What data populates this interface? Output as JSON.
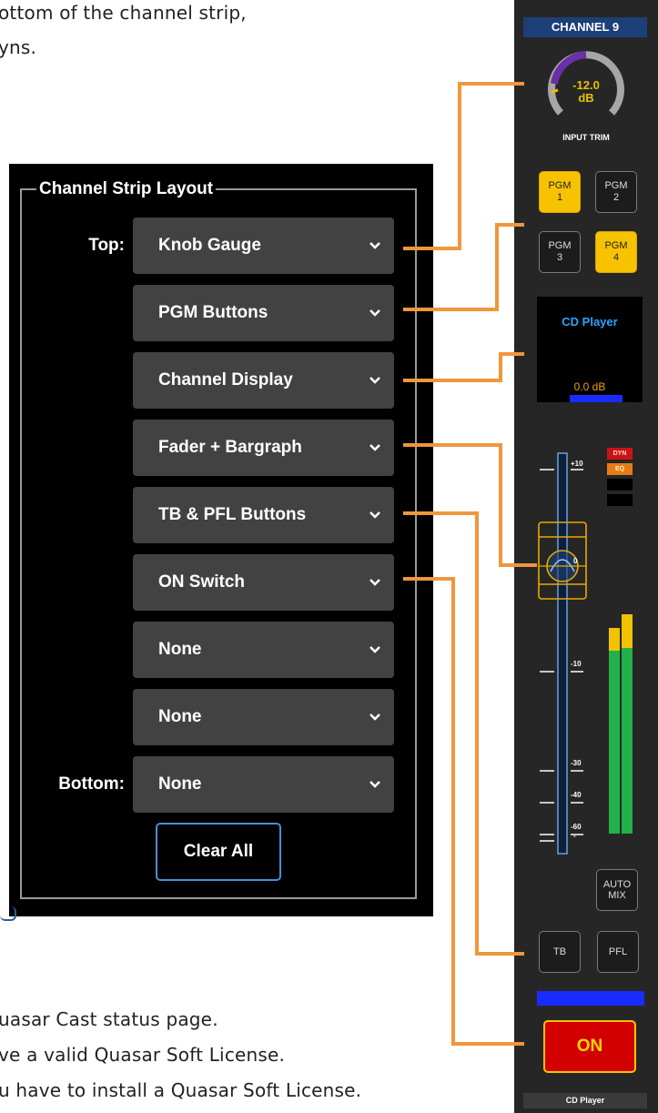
{
  "document": {
    "top_text": [
      "ottom of the channel strip,",
      "yns."
    ],
    "bottom_text": [
      "uasar Cast status page.",
      "ve a valid Quasar Soft License.",
      "u have to install a Quasar Soft License."
    ]
  },
  "layout_panel": {
    "legend": "Channel Strip Layout",
    "top_label": "Top:",
    "bottom_label": "Bottom:",
    "slots": [
      "Knob Gauge",
      "PGM Buttons",
      "Channel Display",
      "Fader + Bargraph",
      "TB & PFL Buttons",
      "ON Switch",
      "None",
      "None",
      "None"
    ],
    "clear_label": "Clear All"
  },
  "strip": {
    "header": "CHANNEL 9",
    "knob": {
      "value": "-12.0",
      "unit": "dB",
      "label": "INPUT TRIM"
    },
    "pgm_buttons": [
      {
        "line1": "PGM",
        "line2": "1",
        "active": true
      },
      {
        "line1": "PGM",
        "line2": "2",
        "active": false
      },
      {
        "line1": "PGM",
        "line2": "3",
        "active": false
      },
      {
        "line1": "PGM",
        "line2": "4",
        "active": true
      }
    ],
    "display": {
      "name": "CD Player",
      "level": "0.0 dB"
    },
    "scale": {
      "t10": "+10",
      "t0": "0",
      "m10": "-10",
      "m30": "-30",
      "m40": "-40",
      "m60": "-60",
      "inf": "-"
    },
    "badges": {
      "dyn": "DYN",
      "eq": "EQ"
    },
    "automix": {
      "line1": "AUTO",
      "line2": "MIX"
    },
    "tb": "TB",
    "pfl": "PFL",
    "on": "ON",
    "footer": "CD Player"
  },
  "colors": {
    "connector": "#f0963c",
    "pgm_active": "#f7c300",
    "header": "#1d3f77",
    "on_button": "#d20000"
  }
}
